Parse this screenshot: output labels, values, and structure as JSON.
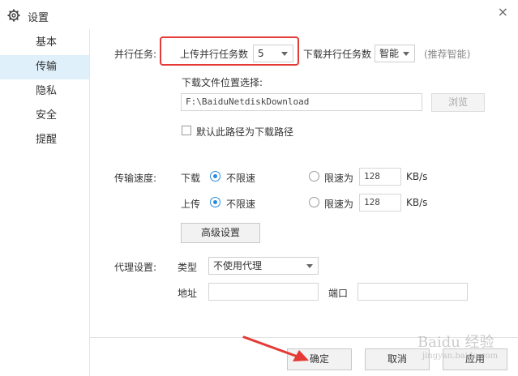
{
  "window": {
    "title": "设置",
    "close_glyph": "×"
  },
  "sidebar": {
    "items": [
      {
        "label": "基本"
      },
      {
        "label": "传输"
      },
      {
        "label": "隐私"
      },
      {
        "label": "安全"
      },
      {
        "label": "提醒"
      }
    ],
    "active_index": 1
  },
  "parallel": {
    "section_label": "并行任务:",
    "upload_label": "上传并行任务数",
    "upload_value": "5",
    "download_label": "下载并行任务数",
    "download_value": "智能",
    "download_hint": "(推荐智能)"
  },
  "location": {
    "label": "下载文件位置选择:",
    "path": "F:\\BaiduNetdiskDownload",
    "browse_label": "浏览",
    "default_checkbox_label": "默认此路径为下载路径"
  },
  "speed": {
    "section_label": "传输速度:",
    "download_label": "下载",
    "upload_label": "上传",
    "unlimited_label": "不限速",
    "limit_label": "限速为",
    "download_limit_value": "128",
    "upload_limit_value": "128",
    "unit": "KB/s",
    "advanced_label": "高级设置"
  },
  "proxy": {
    "section_label": "代理设置:",
    "type_label": "类型",
    "type_value": "不使用代理",
    "address_label": "地址",
    "port_label": "端口"
  },
  "footer": {
    "ok_label": "确定",
    "cancel_label": "取消",
    "apply_label": "应用"
  },
  "watermark": {
    "text": "Baidu 经验",
    "sub": "jingyan.baidu.com"
  },
  "colors": {
    "accent": "#2a8ae0",
    "highlight": "#e53935",
    "sidebar_active": "#dff0fb"
  }
}
